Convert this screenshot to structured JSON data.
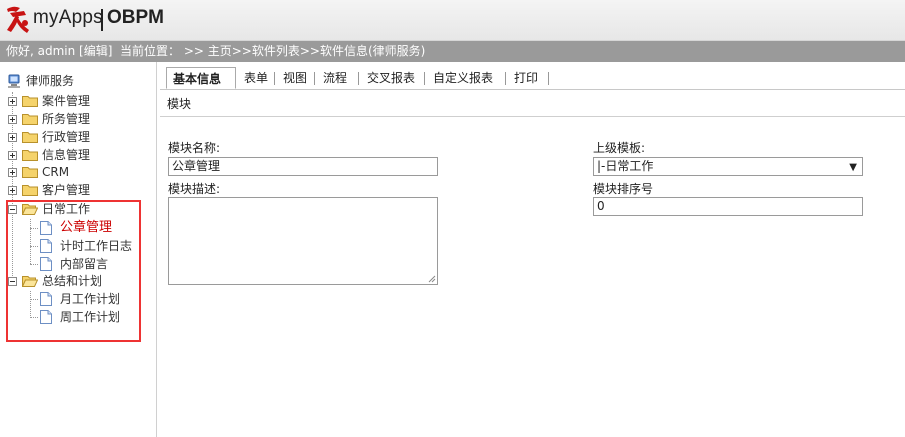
{
  "header": {
    "app_name": "myApps",
    "app_product": "OBPM"
  },
  "infobar": {
    "greeting": "你好, admin [编辑]",
    "location": "当前位置： >> 主页>>软件列表>>软件信息(律师服务)"
  },
  "tree": {
    "root": "律师服务",
    "items": [
      {
        "label": "案件管理",
        "expanded": false
      },
      {
        "label": "所务管理",
        "expanded": false
      },
      {
        "label": "行政管理",
        "expanded": false
      },
      {
        "label": "信息管理",
        "expanded": false
      },
      {
        "label": "CRM",
        "expanded": false
      },
      {
        "label": "客户管理",
        "expanded": false
      },
      {
        "label": "日常工作",
        "expanded": true,
        "children": [
          "公章管理",
          "计时工作日志",
          "内部留言"
        ]
      },
      {
        "label": "总结和计划",
        "expanded": true,
        "children": [
          "月工作计划",
          "周工作计划"
        ]
      }
    ],
    "selected": "公章管理"
  },
  "tabs": [
    "基本信息",
    "表单",
    "视图",
    "流程",
    "交叉报表",
    "自定义报表",
    "打印"
  ],
  "active_tab": "基本信息",
  "section_title": "模块",
  "form": {
    "module_name_label": "模块名称:",
    "module_name_value": "公章管理",
    "module_desc_label": "模块描述:",
    "module_desc_value": "",
    "parent_label": "上级模板:",
    "parent_value": "|-日常工作",
    "order_label": "模块排序号",
    "order_value": "0"
  },
  "colors": {
    "selected_text": "#cc0000",
    "highlight_box": "#ee3333",
    "infobar_bg": "#9a9a9a"
  }
}
